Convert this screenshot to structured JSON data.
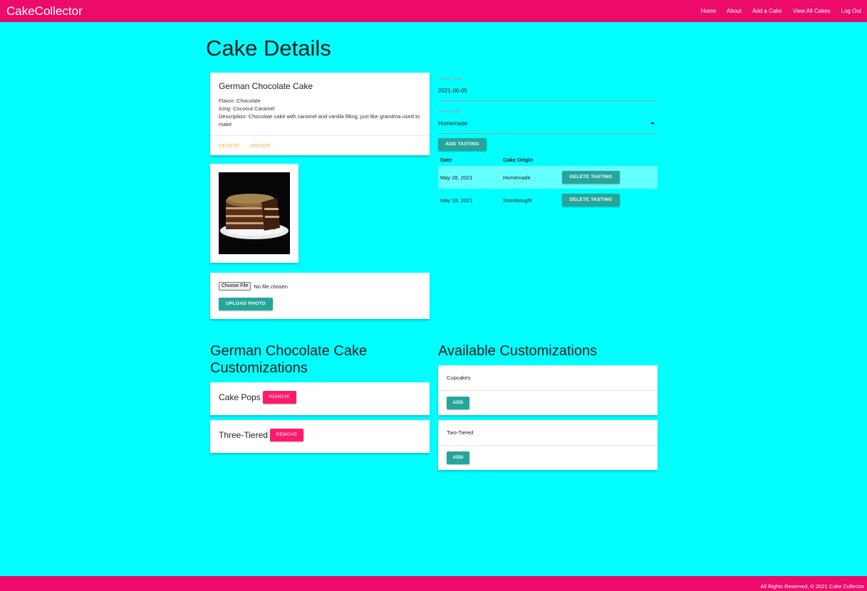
{
  "nav": {
    "brand": "CakeCollector",
    "links": [
      "Home",
      "About",
      "Add a Cake",
      "View All Cakes",
      "Log Out"
    ]
  },
  "page_title": "Cake Details",
  "cake": {
    "name": "German Chocolate Cake",
    "flavor": "Flavor: Chocolate",
    "icing": "Icing: Coconut Caramel",
    "description": "Description: Chocolate cake with caramel and vanilla filling, just like grandma used to make",
    "actions": {
      "delete": "DELETE",
      "update": "UPDATE"
    }
  },
  "upload": {
    "choose_file": "Choose File",
    "no_file": "No file chosen",
    "button": "UPLOAD PHOTO"
  },
  "tasting_form": {
    "date_label": "Tasting Date",
    "date_value": "2021-06-05",
    "origin_label": "Cake Origin",
    "origin_value": "Homemade",
    "add_button": "ADD TASTING"
  },
  "tasting_table": {
    "headers": [
      "Date",
      "Cake Origin"
    ],
    "rows": [
      {
        "date": "May 28, 2021",
        "origin": "Homemade",
        "action": "DELETE TASTING"
      },
      {
        "date": "May 28, 2021",
        "origin": "Storebought",
        "action": "DELETE TASTING"
      }
    ]
  },
  "customizations": {
    "title": "German Chocolate Cake Customizations",
    "items": [
      {
        "name": "Cake Pops",
        "action": "REMOVE"
      },
      {
        "name": "Three-Tiered",
        "action": "REMOVE"
      }
    ]
  },
  "available": {
    "title": "Available Customizations",
    "items": [
      {
        "name": "Cupcakes",
        "action": "ADD"
      },
      {
        "name": "Two-Tiered",
        "action": "ADD"
      }
    ]
  },
  "footer": {
    "text": "All Rights Reserved, © 2021 Cake Collector"
  },
  "colors": {
    "primary": "#ec0b6a",
    "background": "#00ffff",
    "teal": "#26a69a",
    "accent_pink": "#ff1a6b",
    "action_orange": "#ffab40"
  }
}
